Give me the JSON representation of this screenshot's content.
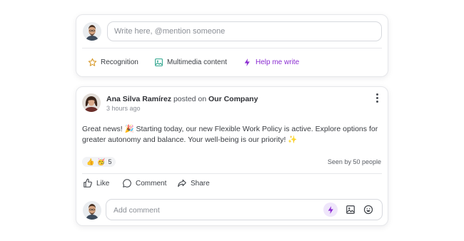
{
  "composer": {
    "placeholder": "Write here, @mention someone",
    "actions": [
      {
        "label": "Recognition",
        "icon": "star-icon",
        "color": "#d89a2b"
      },
      {
        "label": "Multimedia content",
        "icon": "image-icon",
        "color": "#2aa38b"
      },
      {
        "label": "Help me write",
        "icon": "bolt-icon",
        "color": "#8a2bd1"
      }
    ]
  },
  "post": {
    "author": "Ana Silva Ramírez",
    "posted_on": "posted on",
    "company": "Our Company",
    "time": "3 hours ago",
    "body": "Great news! 🎉 Starting today, our new Flexible Work Policy is active. Explore options for greater autonomy and balance. Your well-being is our priority! ✨",
    "reactions": {
      "emojis": [
        "👍",
        "🥳"
      ],
      "count": "5"
    },
    "seen": "Seen by 50 people",
    "actions": {
      "like": "Like",
      "comment": "Comment",
      "share": "Share"
    },
    "comment_placeholder": "Add comment"
  },
  "colors": {
    "accent": "#8a2bd1",
    "accent_bg": "#efe6fb",
    "border": "#e6e7ea"
  }
}
